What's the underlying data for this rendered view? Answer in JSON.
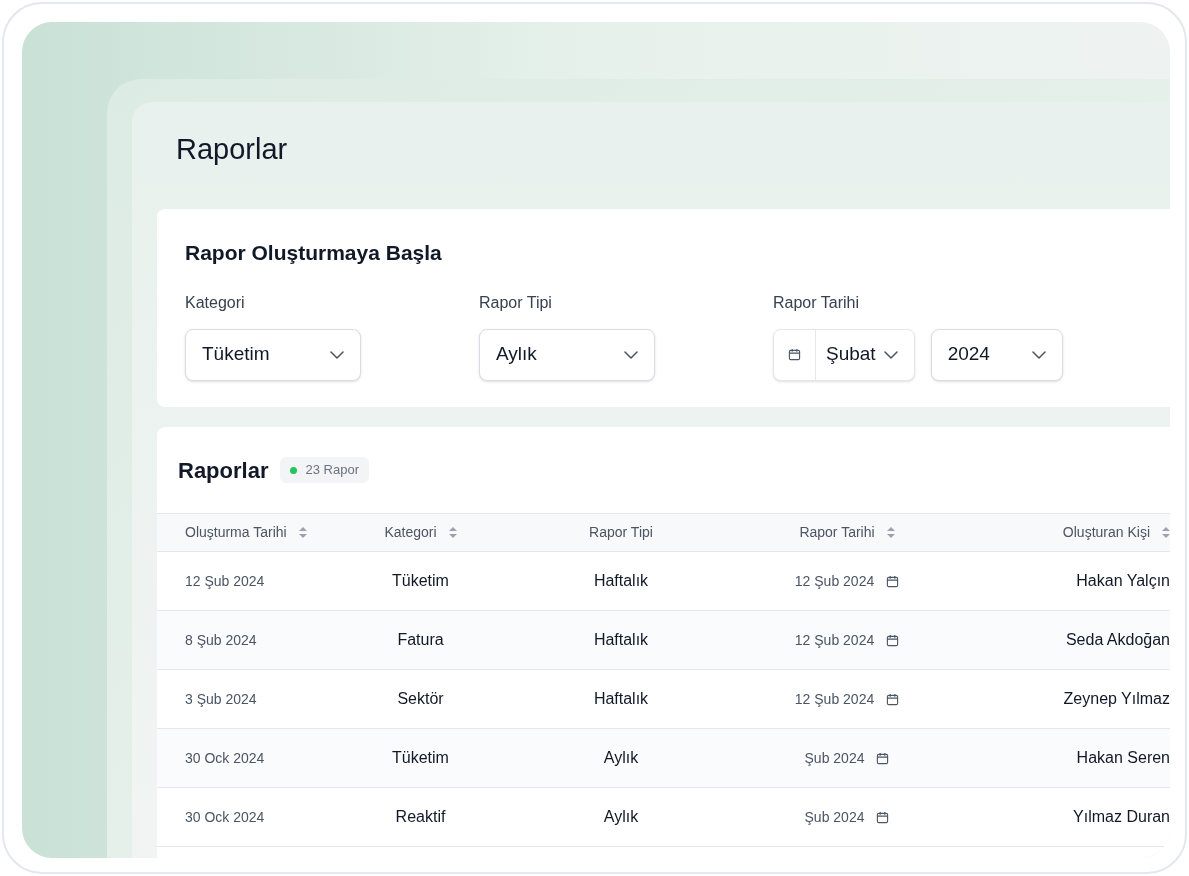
{
  "page_title": "Raporlar",
  "create_card": {
    "title": "Rapor Oluşturmaya Başla",
    "fields": [
      {
        "kind": "select",
        "label": "Kategori",
        "value": "Tüketim"
      },
      {
        "kind": "select",
        "label": "Rapor Tipi",
        "value": "Aylık"
      },
      {
        "kind": "date",
        "label": "Rapor Tarihi",
        "month": "Şubat",
        "year": "2024"
      }
    ]
  },
  "reports": {
    "title": "Raporlar",
    "badge": {
      "text": "23 Rapor",
      "color": "#22c55e"
    },
    "columns": [
      {
        "label": "Oluşturma Tarihi",
        "sortable": true
      },
      {
        "label": "Kategori",
        "sortable": true
      },
      {
        "label": "Rapor Tipi",
        "sortable": false
      },
      {
        "label": "Rapor Tarihi",
        "sortable": true
      },
      {
        "label": "Oluşturan Kişi",
        "sortable": true
      }
    ],
    "rows": [
      {
        "created": "12 Şub 2024",
        "category": "Tüketim",
        "type": "Haftalık",
        "report_date": "12 Şub 2024",
        "author": "Hakan Yalçın"
      },
      {
        "created": "8 Şub 2024",
        "category": "Fatura",
        "type": "Haftalık",
        "report_date": "12 Şub 2024",
        "author": "Seda Akdoğan"
      },
      {
        "created": "3 Şub 2024",
        "category": "Sektör",
        "type": "Haftalık",
        "report_date": "12 Şub 2024",
        "author": "Zeynep Yılmaz"
      },
      {
        "created": "30 Ock 2024",
        "category": "Tüketim",
        "type": "Aylık",
        "report_date": "Şub 2024",
        "author": "Hakan Seren"
      },
      {
        "created": "30 Ock 2024",
        "category": "Reaktif",
        "type": "Aylık",
        "report_date": "Şub 2024",
        "author": "Yılmaz Duran"
      }
    ]
  }
}
